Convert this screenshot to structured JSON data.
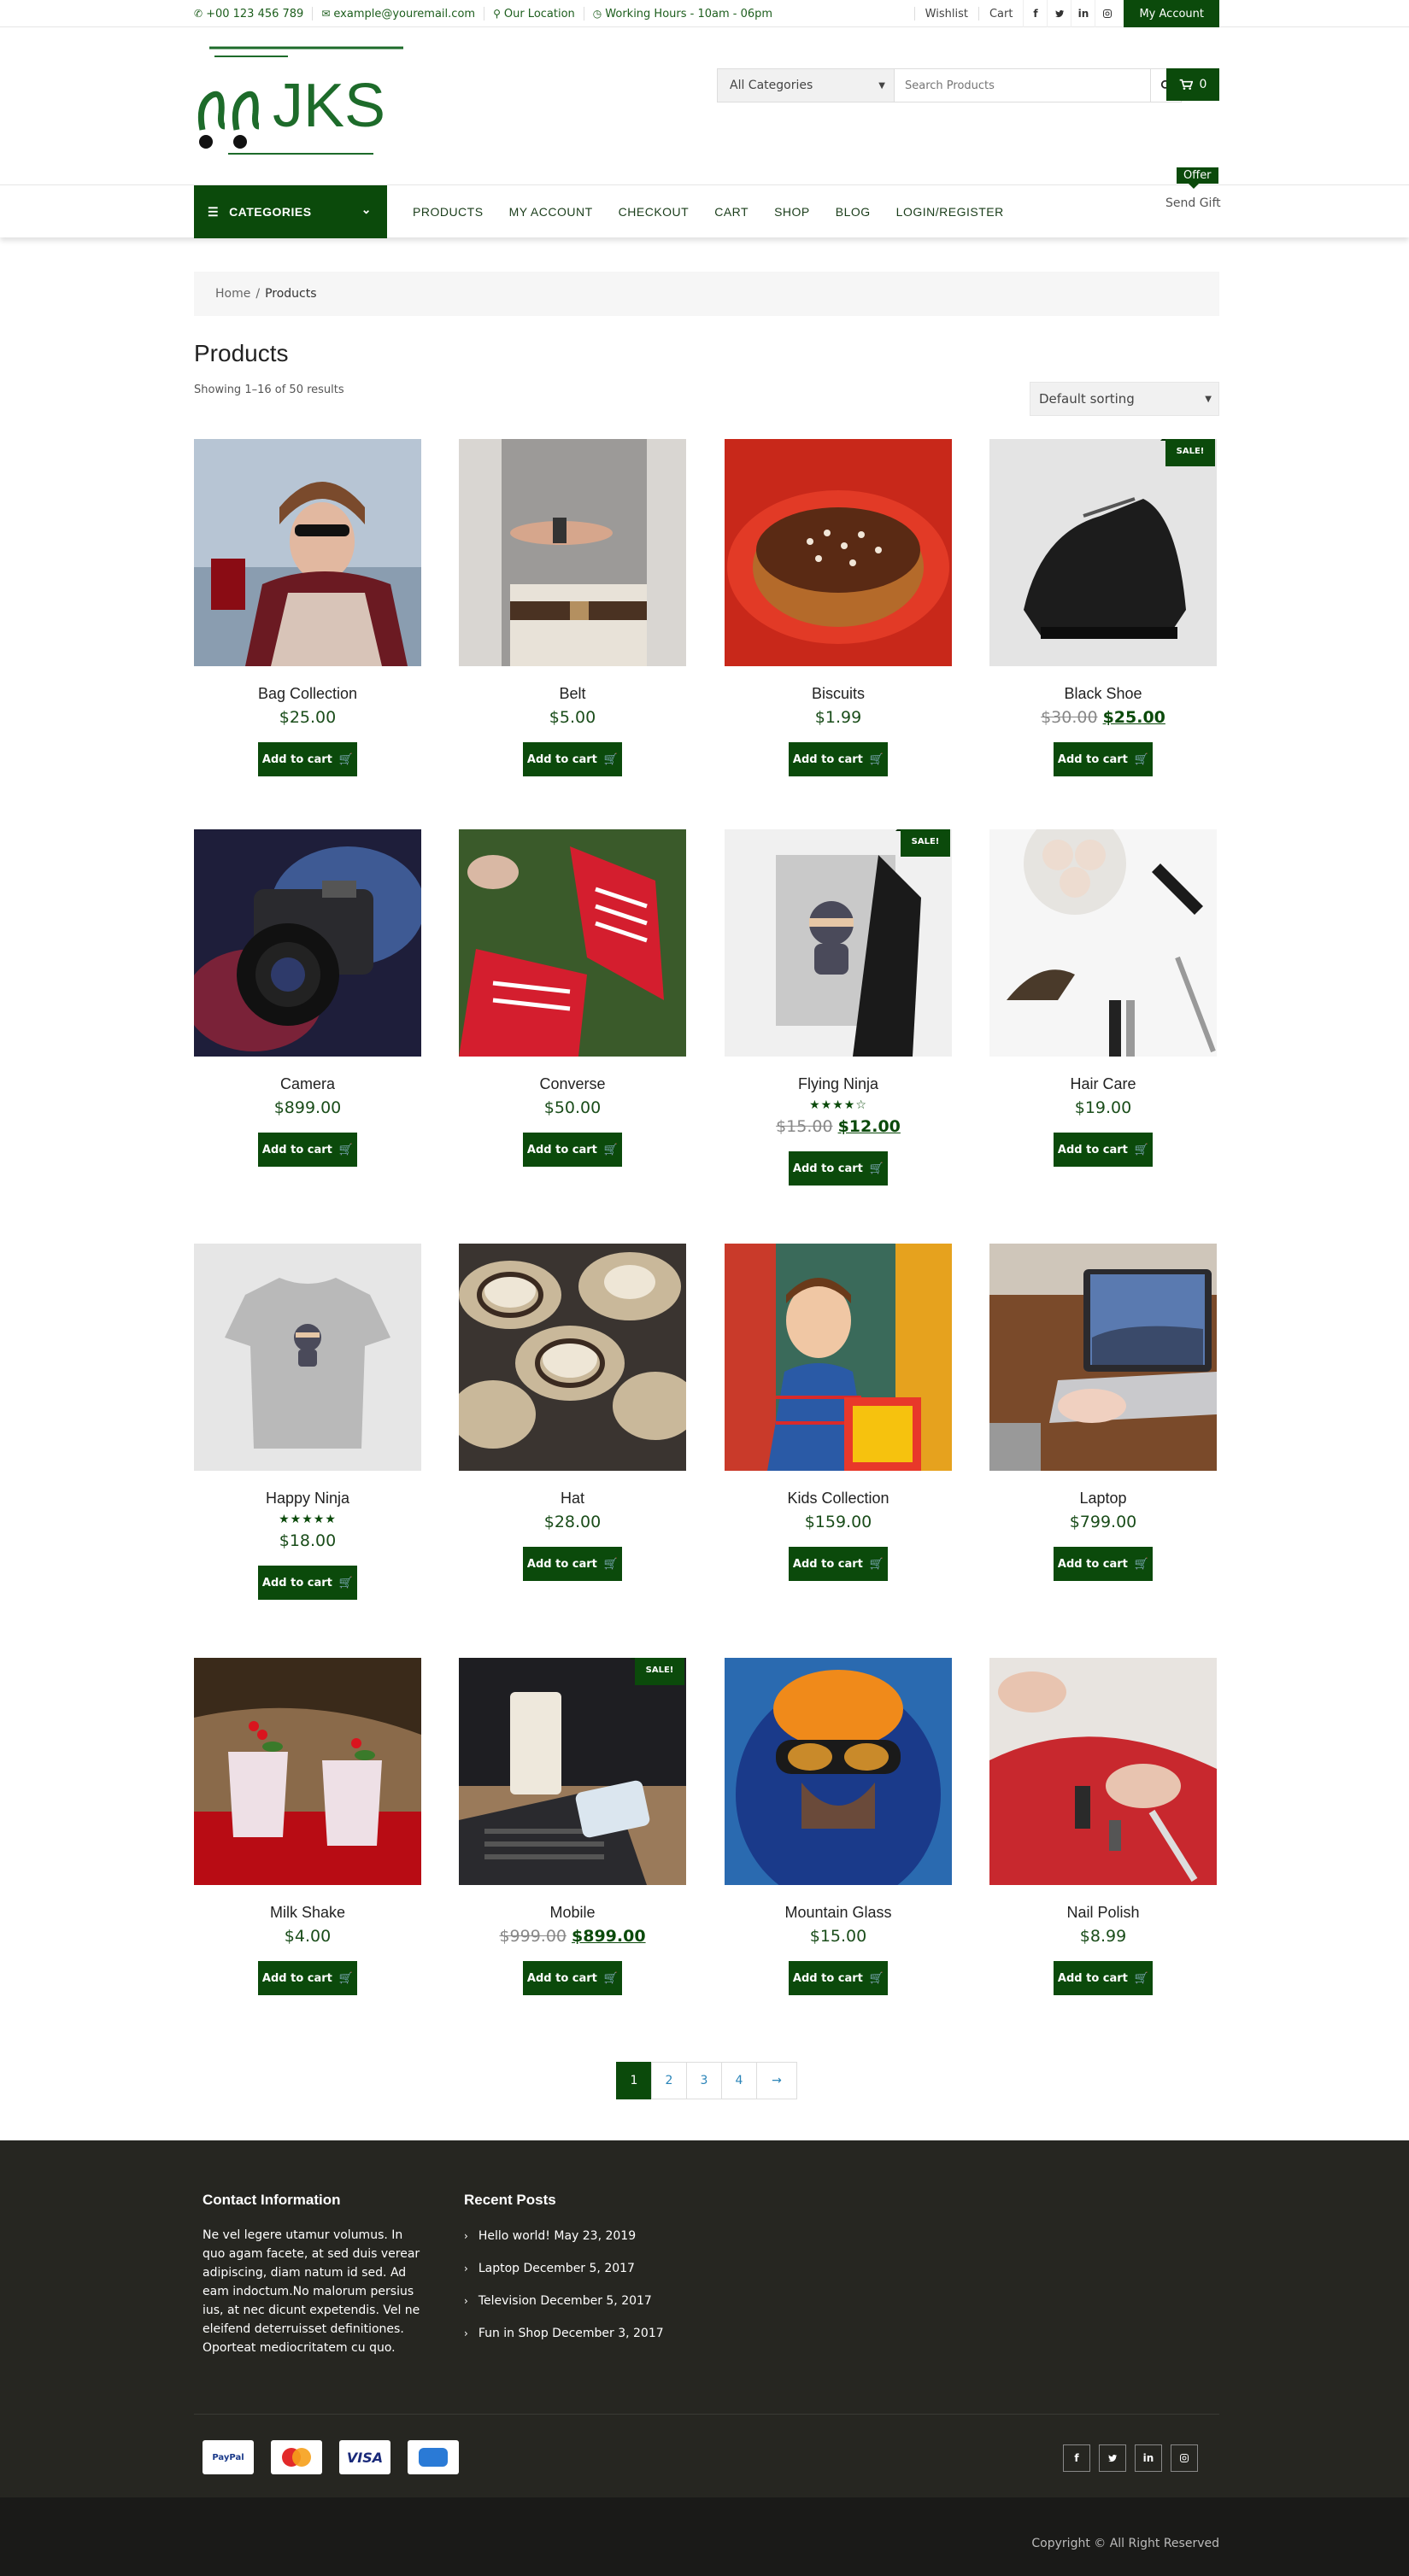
{
  "topbar": {
    "phone": "+00 123 456 789",
    "email": "example@youremail.com",
    "location": "Our Location",
    "hours": "Working Hours - 10am - 06pm",
    "wishlist": "Wishlist",
    "cart": "Cart",
    "social": [
      "f",
      "t",
      "in",
      "ig"
    ],
    "account": "My Account"
  },
  "logo": {
    "text": "JKS"
  },
  "search": {
    "category": "All Categories",
    "placeholder": "Search Products"
  },
  "cart": {
    "count": "0"
  },
  "nav": {
    "categories": "CATEGORIES",
    "links": [
      "PRODUCTS",
      "MY ACCOUNT",
      "CHECKOUT",
      "CART",
      "SHOP",
      "BLOG",
      "LOGIN/REGISTER"
    ],
    "offer": "Offer",
    "send_gift": "Send Gift"
  },
  "breadcrumb": {
    "home": "Home",
    "sep": "/",
    "current": "Products"
  },
  "page": {
    "title": "Products",
    "result_count": "Showing 1–16 of 50 results",
    "sorting": "Default sorting"
  },
  "products": [
    {
      "name": "Bag Collection",
      "price": "$25.00"
    },
    {
      "name": "Belt",
      "price": "$5.00"
    },
    {
      "name": "Biscuits",
      "price": "$1.99"
    },
    {
      "name": "Black Shoe",
      "old_price": "$30.00",
      "price": "$25.00",
      "sale": "SALE!"
    },
    {
      "name": "Camera",
      "price": "$899.00"
    },
    {
      "name": "Converse",
      "price": "$50.00"
    },
    {
      "name": "Flying Ninja",
      "old_price": "$15.00",
      "price": "$12.00",
      "sale": "SALE!",
      "rating": 4
    },
    {
      "name": "Hair Care",
      "price": "$19.00"
    },
    {
      "name": "Happy Ninja",
      "price": "$18.00",
      "rating": 5
    },
    {
      "name": "Hat",
      "price": "$28.00"
    },
    {
      "name": "Kids Collection",
      "price": "$159.00"
    },
    {
      "name": "Laptop",
      "price": "$799.00"
    },
    {
      "name": "Milk Shake",
      "price": "$4.00"
    },
    {
      "name": "Mobile",
      "old_price": "$999.00",
      "price": "$899.00",
      "sale": "SALE!"
    },
    {
      "name": "Mountain Glass",
      "price": "$15.00"
    },
    {
      "name": "Nail Polish",
      "price": "$8.99"
    }
  ],
  "add_to_cart": "Add to cart",
  "pagination": [
    "1",
    "2",
    "3",
    "4",
    "→"
  ],
  "footer": {
    "contact_title": "Contact Information",
    "contact_text": "Ne vel legere utamur volumus. In quo agam facete, at sed duis verear adipiscing, diam natum id sed. Ad eam indoctum.No malorum persius ius, at nec dicunt expetendis. Vel ne eleifend deterruisset definitiones. Oporteat mediocritatem cu quo.",
    "posts_title": "Recent Posts",
    "posts": [
      "Hello world! May 23, 2019",
      "Laptop December 5, 2017",
      "Television December 5, 2017",
      "Fun in Shop December 3, 2017"
    ],
    "payments": [
      "PayPal",
      "MasterCard",
      "VISA",
      "Amex"
    ],
    "social": [
      "f",
      "t",
      "in",
      "ig"
    ],
    "copyright": "Copyright © All Right Reserved"
  },
  "colors": {
    "brand": "#0b4a0b",
    "footer": "#262621",
    "link": "#2a84b8"
  }
}
